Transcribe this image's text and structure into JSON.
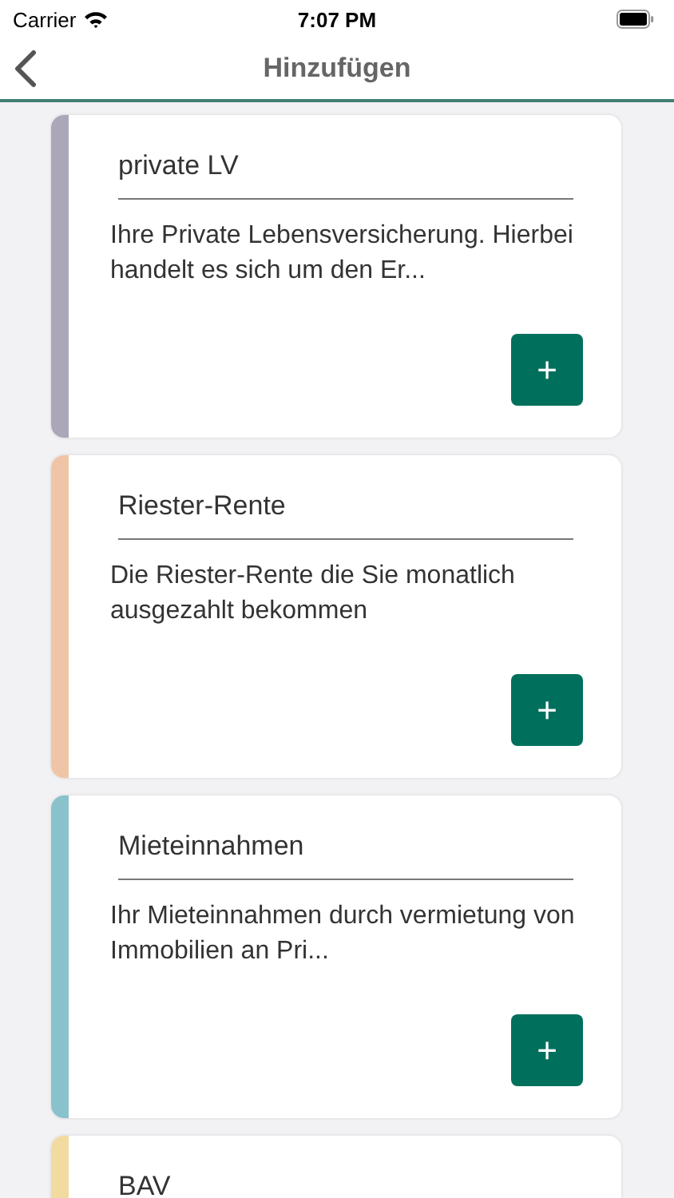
{
  "status_bar": {
    "carrier": "Carrier",
    "time": "7:07 PM"
  },
  "nav": {
    "title": "Hinzufügen"
  },
  "cards": [
    {
      "title": "private LV",
      "description": "Ihre Private Lebensversicherung. Hierbei handelt es sich um den Er...",
      "color": "#aca6b9",
      "button": "+"
    },
    {
      "title": "Riester-Rente",
      "description": "Die Riester-Rente die Sie monatlich ausgezahlt bekommen",
      "color": "#f0c4a6",
      "button": "+"
    },
    {
      "title": "Mieteinnahmen",
      "description": "Ihr Mieteinnahmen durch vermietung von Immobilien an Pri...",
      "color": "#8ac2cc",
      "button": "+"
    },
    {
      "title": "BAV",
      "color": "#f2dba0"
    }
  ]
}
